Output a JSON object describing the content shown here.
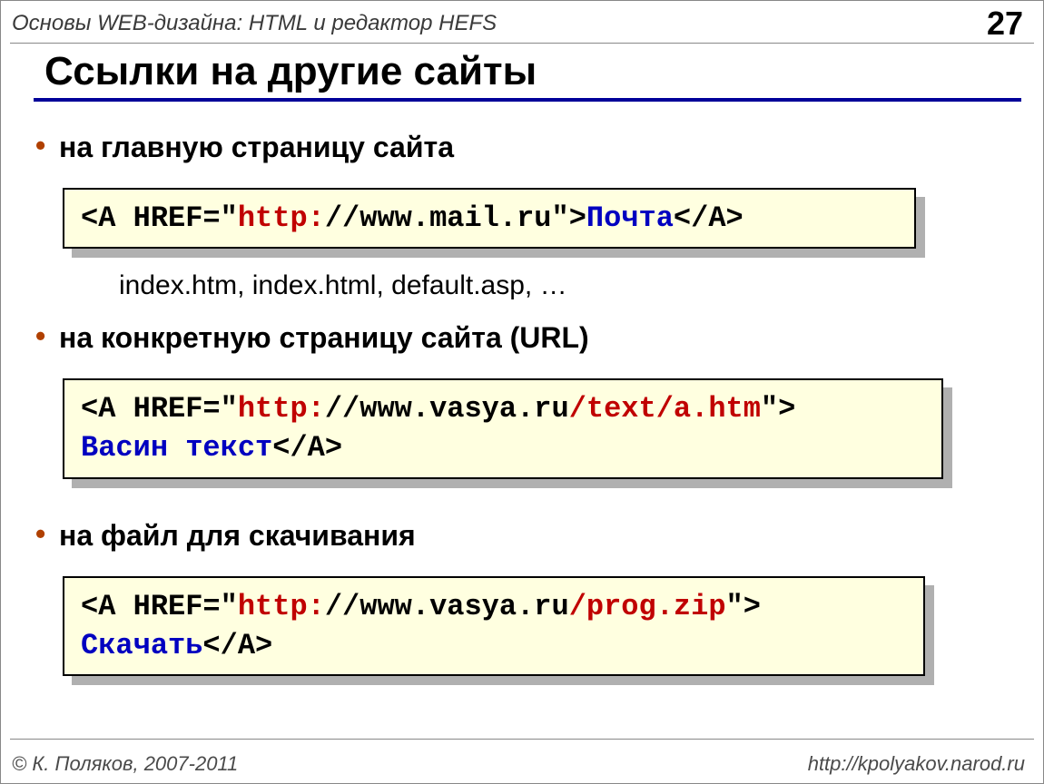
{
  "header": {
    "breadcrumb": "Основы WEB-дизайна: HTML и редактор HEFS",
    "page_number": "27"
  },
  "title": "Ссылки на другие сайты",
  "sections": {
    "main_page": {
      "bullet": "на главную страницу сайта",
      "code": {
        "p1": "<A HREF=\"",
        "p2": "http:",
        "p3": "//www.mail.ru\">",
        "p4": "Почта",
        "p5": "</A>"
      },
      "note": "index.htm, index.html, default.asp, …"
    },
    "specific_page": {
      "bullet": "на конкретную страницу сайта (URL)",
      "code": {
        "p1": "<A HREF=\"",
        "p2": "http:",
        "p3": "//www.vasya.ru",
        "p4": "/text/a.htm",
        "p5": "\">",
        "p6": "Васин текст",
        "p7": "</A>"
      }
    },
    "download": {
      "bullet": "на файл для скачивания",
      "code": {
        "p1": "<A HREF=\"",
        "p2": "http:",
        "p3": "//www.vasya.ru",
        "p4": "/prog.zip",
        "p5": "\">",
        "p6": "Скачать",
        "p7": "</A>"
      }
    }
  },
  "footer": {
    "copyright": "© К. Поляков, 2007-2011",
    "url": "http://kpolyakov.narod.ru"
  }
}
